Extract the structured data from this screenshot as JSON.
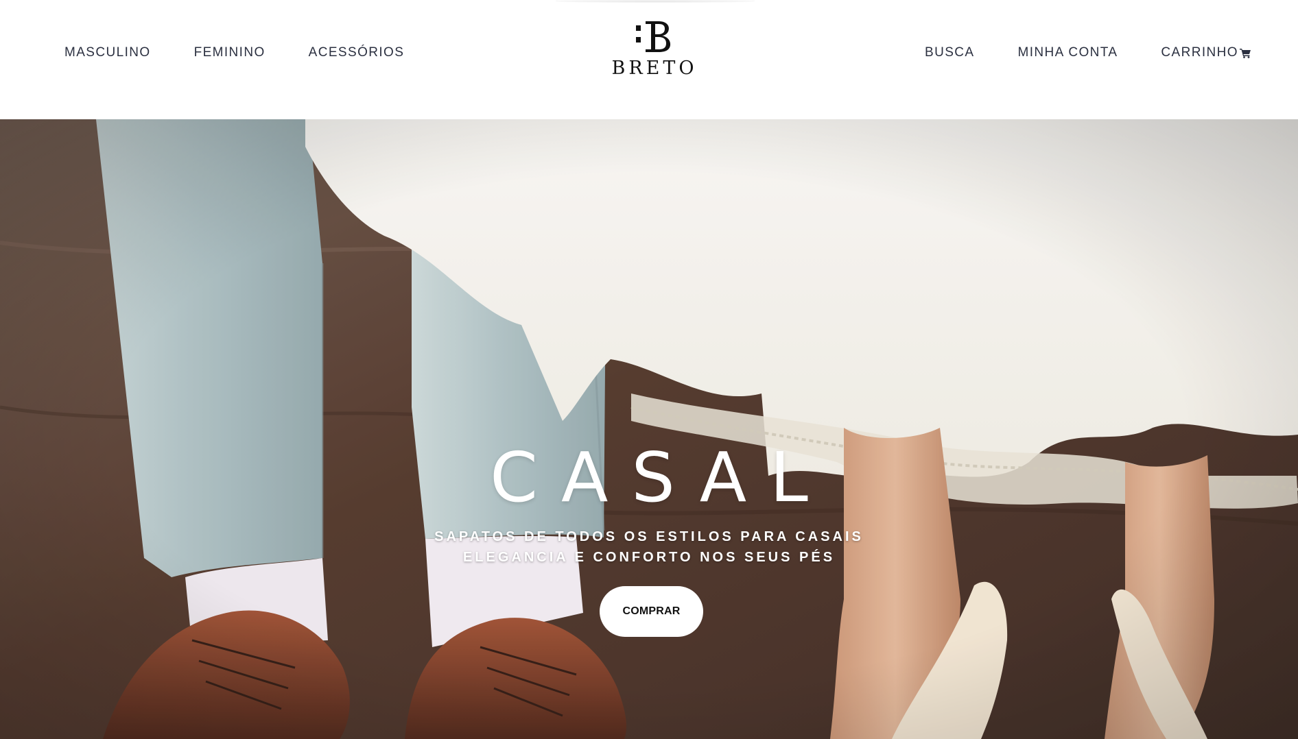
{
  "nav": {
    "left": [
      "MASCULINO",
      "FEMININO",
      "ACESSÓRIOS"
    ],
    "right": {
      "search": "BUSCA",
      "account": "MINHA CONTA",
      "cart": "CARRINHO"
    }
  },
  "logo": {
    "text": "BRETO",
    "icon": "b-monogram-logo"
  },
  "hero": {
    "title": "CASAL",
    "subtitle_line1": "SAPATOS DE TODOS OS ESTILOS PARA CASAIS",
    "subtitle_line2": "ELEGANCIA E CONFORTO NOS SEUS PÉS",
    "cta": "COMPRAR"
  },
  "icons": {
    "cart": "shopping-cart-icon"
  },
  "colors": {
    "nav_text": "#2b3040",
    "hero_text": "#ffffff",
    "button_bg": "#ffffff",
    "button_text": "#111111"
  }
}
